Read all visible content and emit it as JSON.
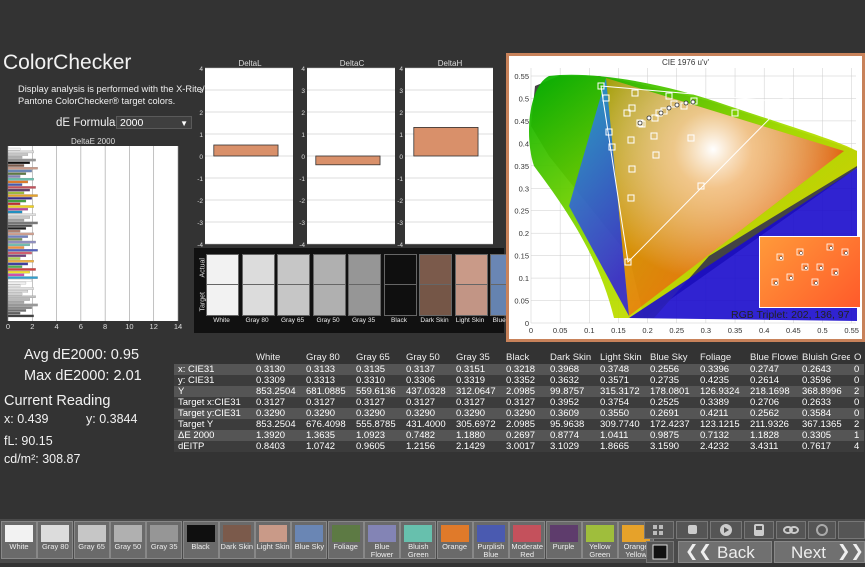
{
  "app": {
    "title": "ColorChecker",
    "description": "Display analysis is performed with the X-Rite/ Pantone ColorChecker® target colors.",
    "de_formula_label": "dE Formula:",
    "de_formula_value": "2000"
  },
  "delta_charts": [
    {
      "title": "DeltaL",
      "value": 0.5
    },
    {
      "title": "DeltaC",
      "value": -0.4
    },
    {
      "title": "DeltaH",
      "value": 1.3
    }
  ],
  "delta_axis": {
    "ticks": [
      "4",
      "3",
      "2",
      "1",
      "0",
      "-1",
      "-2",
      "-3",
      "-4"
    ]
  },
  "deltaE_chart": {
    "title": "DeltaE 2000",
    "ticks": [
      "0",
      "2",
      "4",
      "6",
      "8",
      "10",
      "12",
      "14"
    ]
  },
  "swatch_compare": {
    "actual_label": "Actual",
    "target_label": "Target",
    "items": [
      {
        "name": "White",
        "actual": "#f2f2f2",
        "target": "#f2f2f2"
      },
      {
        "name": "Gray 80",
        "actual": "#dcdcdc",
        "target": "#dcdcdc"
      },
      {
        "name": "Gray 65",
        "actual": "#c6c6c6",
        "target": "#c6c6c6"
      },
      {
        "name": "Gray 50",
        "actual": "#b0b0b0",
        "target": "#b0b0b0"
      },
      {
        "name": "Gray 35",
        "actual": "#969696",
        "target": "#969696"
      },
      {
        "name": "Black",
        "actual": "#0f0f0f",
        "target": "#0f0f0f"
      },
      {
        "name": "Dark Skin",
        "actual": "#7b5a4b",
        "target": "#755647"
      },
      {
        "name": "Light Skin",
        "actual": "#c99a88",
        "target": "#c29585"
      },
      {
        "name": "Blue Sky",
        "actual": "#6a86b4",
        "target": "#6583b0"
      }
    ]
  },
  "cie": {
    "title": "CIE 1976 u'v'",
    "y_ticks": [
      "0.55",
      "0.5",
      "0.45",
      "0.4",
      "0.35",
      "0.3",
      "0.25",
      "0.2",
      "0.15",
      "0.1",
      "0.05",
      "0"
    ],
    "x_ticks": [
      "0",
      "0.05",
      "0.1",
      "0.15",
      "0.2",
      "0.25",
      "0.3",
      "0.35",
      "0.4",
      "0.45",
      "0.5",
      "0.55"
    ],
    "rgb_triplet": "RGB Triplet: 202, 136, 97"
  },
  "readings": {
    "avg": "Avg dE2000: 0.95",
    "max": "Max dE2000: 2.01",
    "current_title": "Current Reading",
    "x": "x: 0.439",
    "y": "y: 0.3844",
    "fl": "fL: 90.15",
    "cdm2": "cd/m²: 308.87"
  },
  "table": {
    "headers": [
      "",
      "White",
      "Gray 80",
      "Gray 65",
      "Gray 50",
      "Gray 35",
      "Black",
      "Dark Skin",
      "Light Skin",
      "Blue Sky",
      "Foliage",
      "Blue Flower",
      "Bluish Green",
      "O"
    ],
    "rows": [
      [
        "x: CIE31",
        "0.3130",
        "0.3133",
        "0.3135",
        "0.3137",
        "0.3151",
        "0.3218",
        "0.3968",
        "0.3748",
        "0.2556",
        "0.3396",
        "0.2747",
        "0.2643",
        "0"
      ],
      [
        "y: CIE31",
        "0.3309",
        "0.3313",
        "0.3310",
        "0.3306",
        "0.3319",
        "0.3352",
        "0.3632",
        "0.3571",
        "0.2735",
        "0.4235",
        "0.2614",
        "0.3596",
        "0"
      ],
      [
        "Y",
        "853.2504",
        "681.0885",
        "559.6136",
        "437.0328",
        "312.0647",
        "2.0985",
        "99.8757",
        "315.3172",
        "178.0801",
        "126.9324",
        "218.1698",
        "368.8996",
        "2"
      ],
      [
        "Target x:CIE31",
        "0.3127",
        "0.3127",
        "0.3127",
        "0.3127",
        "0.3127",
        "0.3127",
        "0.3952",
        "0.3754",
        "0.2525",
        "0.3389",
        "0.2706",
        "0.2633",
        "0"
      ],
      [
        "Target y:CIE31",
        "0.3290",
        "0.3290",
        "0.3290",
        "0.3290",
        "0.3290",
        "0.3290",
        "0.3609",
        "0.3550",
        "0.2691",
        "0.4211",
        "0.2562",
        "0.3584",
        "0"
      ],
      [
        "Target Y",
        "853.2504",
        "676.4098",
        "555.8785",
        "431.4000",
        "305.6972",
        "2.0985",
        "95.9638",
        "309.7740",
        "172.4237",
        "123.1215",
        "211.9326",
        "367.1365",
        "2"
      ],
      [
        "ΔE 2000",
        "1.3920",
        "1.3635",
        "1.0923",
        "0.7482",
        "1.1880",
        "0.2697",
        "0.8774",
        "1.0411",
        "0.9875",
        "0.7132",
        "1.1828",
        "0.3305",
        "1"
      ],
      [
        "dEITP",
        "0.8403",
        "1.0742",
        "0.9605",
        "1.2156",
        "2.1429",
        "3.0017",
        "3.1029",
        "1.8665",
        "3.1590",
        "2.4232",
        "3.4311",
        "0.7617",
        "4"
      ]
    ]
  },
  "bottom_swatches": [
    {
      "name": "White",
      "color": "#f2f2f2"
    },
    {
      "name": "Gray 80",
      "color": "#dcdcdc"
    },
    {
      "name": "Gray 65",
      "color": "#c6c6c6"
    },
    {
      "name": "Gray 50",
      "color": "#b0b0b0"
    },
    {
      "name": "Gray 35",
      "color": "#969696"
    },
    {
      "name": "Black",
      "color": "#0f0f0f"
    },
    {
      "name": "Dark Skin",
      "color": "#7b5a4b"
    },
    {
      "name": "Light Skin",
      "color": "#c99a88"
    },
    {
      "name": "Blue Sky",
      "color": "#6a86b4"
    },
    {
      "name": "Foliage",
      "color": "#5d7a44"
    },
    {
      "name": "Blue Flower",
      "color": "#8384b5"
    },
    {
      "name": "Bluish Green",
      "color": "#67c0ad"
    },
    {
      "name": "Orange",
      "color": "#e07a2a"
    },
    {
      "name": "Purplish Blue",
      "color": "#4a5ab0"
    },
    {
      "name": "Moderate Red",
      "color": "#c4515c"
    },
    {
      "name": "Purple",
      "color": "#5e3c6c"
    },
    {
      "name": "Yellow Green",
      "color": "#9fbe3c"
    },
    {
      "name": "Orange Yellow",
      "color": "#e6a22a"
    }
  ],
  "nav": {
    "back": "Back",
    "next": "Next"
  },
  "colors": {
    "accent_border": "#c8825a",
    "bar_fill": "#d9906a"
  }
}
